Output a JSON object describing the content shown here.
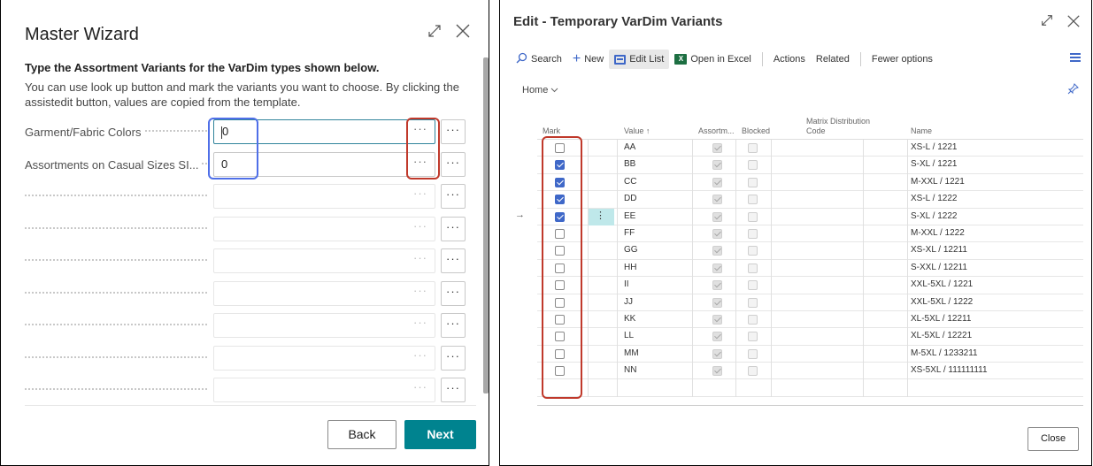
{
  "master_wizard": {
    "title": "Master Wizard",
    "heading": "Type the Assortment Variants for the VarDim types shown below.",
    "description": "You can use look up button and mark the variants you want to choose. By clicking the assistedit button, values are copied from the template.",
    "fields": [
      {
        "label": "Garment/Fabric Colors",
        "value": "0",
        "focused": true
      },
      {
        "label": "Assortments on Casual Sizes SI...",
        "value": "0",
        "focused": false
      },
      {
        "label": "",
        "value": "",
        "focused": false
      },
      {
        "label": "",
        "value": "",
        "focused": false
      },
      {
        "label": "",
        "value": "",
        "focused": false
      },
      {
        "label": "",
        "value": "",
        "focused": false
      },
      {
        "label": "",
        "value": "",
        "focused": false
      },
      {
        "label": "",
        "value": "",
        "focused": false
      },
      {
        "label": "",
        "value": "",
        "focused": false
      }
    ],
    "ellipsis": "···",
    "back_label": "Back",
    "next_label": "Next",
    "accent_color": "#00838f"
  },
  "variants_page": {
    "title": "Edit - Temporary VarDim Variants",
    "toolbar": {
      "search": "Search",
      "new": "New",
      "edit_list": "Edit List",
      "open_in_excel": "Open in Excel",
      "actions": "Actions",
      "related": "Related",
      "fewer_options": "Fewer options",
      "excel_letter": "X"
    },
    "home_label": "Home",
    "columns": {
      "mark": "Mark",
      "value": "Value ↑",
      "assortment": "Assortm...",
      "blocked": "Blocked",
      "matrix_line1": "Matrix Distribution",
      "matrix_line2": "Code",
      "name": "Name"
    },
    "rows": [
      {
        "mark": false,
        "value": "AA",
        "assortment": true,
        "blocked": false,
        "name": "XS-L / 1221"
      },
      {
        "mark": true,
        "value": "BB",
        "assortment": true,
        "blocked": false,
        "name": "S-XL / 1221"
      },
      {
        "mark": true,
        "value": "CC",
        "assortment": true,
        "blocked": false,
        "name": "M-XXL / 1221"
      },
      {
        "mark": true,
        "value": "DD",
        "assortment": true,
        "blocked": false,
        "name": "XS-L / 1222"
      },
      {
        "mark": true,
        "value": "EE",
        "assortment": true,
        "blocked": false,
        "name": "S-XL / 1222",
        "selected": true
      },
      {
        "mark": false,
        "value": "FF",
        "assortment": true,
        "blocked": false,
        "name": "M-XXL / 1222"
      },
      {
        "mark": false,
        "value": "GG",
        "assortment": true,
        "blocked": false,
        "name": "XS-XL / 12211"
      },
      {
        "mark": false,
        "value": "HH",
        "assortment": true,
        "blocked": false,
        "name": "S-XXL / 12211"
      },
      {
        "mark": false,
        "value": "II",
        "assortment": true,
        "blocked": false,
        "name": "XXL-5XL / 1221"
      },
      {
        "mark": false,
        "value": "JJ",
        "assortment": true,
        "blocked": false,
        "name": "XXL-5XL / 1222"
      },
      {
        "mark": false,
        "value": "KK",
        "assortment": true,
        "blocked": false,
        "name": "XL-5XL / 12211"
      },
      {
        "mark": false,
        "value": "LL",
        "assortment": true,
        "blocked": false,
        "name": "XL-5XL / 12221"
      },
      {
        "mark": false,
        "value": "MM",
        "assortment": true,
        "blocked": false,
        "name": "M-5XL / 1233211"
      },
      {
        "mark": false,
        "value": "NN",
        "assortment": true,
        "blocked": false,
        "name": "XS-5XL / 111111111"
      }
    ],
    "close_label": "Close",
    "accent_color": "#3f68c8"
  }
}
